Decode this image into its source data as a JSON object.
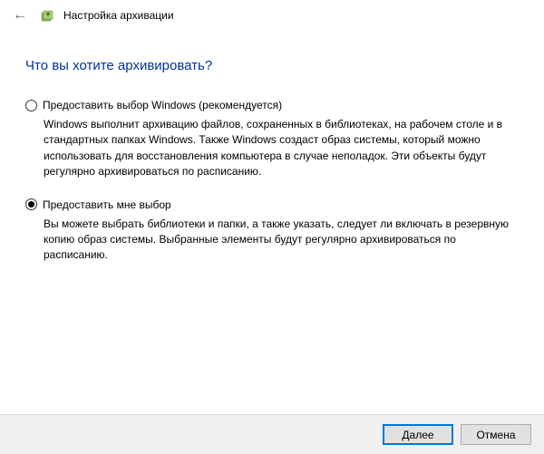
{
  "header": {
    "title": "Настройка архивации"
  },
  "main": {
    "heading": "Что вы хотите архивировать?",
    "options": [
      {
        "label": "Предоставить выбор Windows (рекомендуется)",
        "description": "Windows выполнит архивацию файлов, сохраненных в библиотеках, на рабочем столе и в стандартных папках Windows. Также Windows создаст образ системы, который можно использовать для восстановления компьютера в случае неполадок. Эти объекты будут регулярно архивироваться по расписанию.",
        "selected": false
      },
      {
        "label": "Предоставить мне выбор",
        "description": "Вы можете выбрать библиотеки и папки, а также указать, следует ли включать в резервную копию образ системы. Выбранные элементы будут регулярно архивироваться по расписанию.",
        "selected": true
      }
    ]
  },
  "footer": {
    "next_label": "Далее",
    "cancel_label": "Отмена"
  }
}
